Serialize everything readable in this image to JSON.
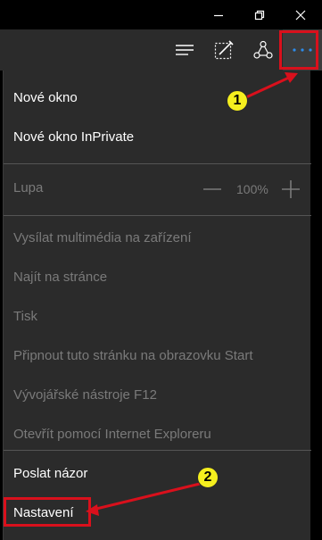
{
  "window_controls": {
    "minimize_icon": "minimize-icon",
    "restore_icon": "restore-icon",
    "close_icon": "close-icon"
  },
  "toolbar": {
    "icons": [
      "hub-icon",
      "web-note-icon",
      "share-icon",
      "more-actions-icon"
    ]
  },
  "menu": {
    "new_window": "Nové okno",
    "new_inprivate_window": "Nové okno InPrivate",
    "zoom_label": "Lupa",
    "zoom_value": "100%",
    "cast_media": "Vysílat multimédia na zařízení",
    "find_on_page": "Najít na stránce",
    "print": "Tisk",
    "pin_to_start": "Připnout tuto stránku na obrazovku Start",
    "dev_tools": "Vývojářské nástroje F12",
    "open_with_ie": "Otevřít pomocí Internet Exploreru",
    "send_feedback": "Poslat názor",
    "settings": "Nastavení"
  },
  "annotations": {
    "badge_1": "1",
    "badge_2": "2",
    "highlight_color": "#d9101c",
    "badge_color": "#f5ef1e"
  }
}
